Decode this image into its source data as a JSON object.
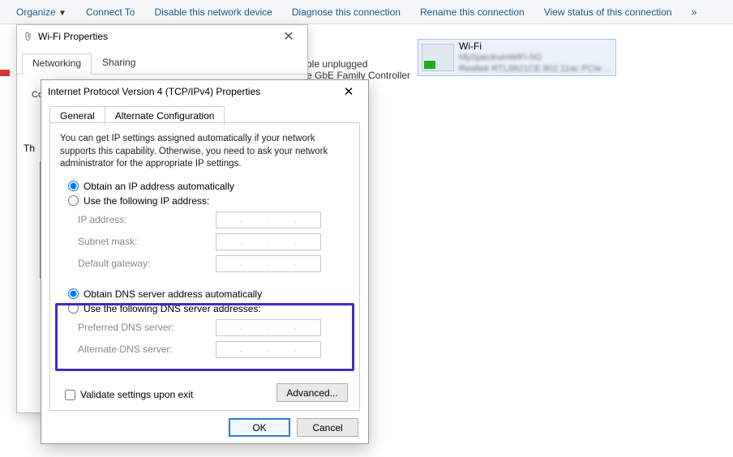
{
  "toolbar": {
    "organize": "Organize",
    "connect_to": "Connect To",
    "disable": "Disable this network device",
    "diagnose": "Diagnose this connection",
    "rename": "Rename this connection",
    "view_status": "View status of this connection",
    "more": "»"
  },
  "wifi_tile": {
    "title": "Wi-Fi",
    "line2": "MySpectrumWiFi-5G",
    "line3": "Realtek RTL8821CE 802.11ac PCIe ..."
  },
  "peek": {
    "unplugged": "ble unplugged",
    "controller": "e GbE Family Controller"
  },
  "dlg1": {
    "title": "Wi-Fi Properties",
    "tab_networking": "Networking",
    "tab_sharing": "Sharing",
    "connect_using": "Co",
    "th": "Th"
  },
  "dlg2": {
    "title": "Internet Protocol Version 4 (TCP/IPv4) Properties",
    "tab_general": "General",
    "tab_alt": "Alternate Configuration",
    "description": "You can get IP settings assigned automatically if your network supports this capability. Otherwise, you need to ask your network administrator for the appropriate IP settings.",
    "radio_ip_auto": "Obtain an IP address automatically",
    "radio_ip_manual": "Use the following IP address:",
    "ip_address": "IP address:",
    "subnet": "Subnet mask:",
    "gateway": "Default gateway:",
    "radio_dns_auto": "Obtain DNS server address automatically",
    "radio_dns_manual": "Use the following DNS server addresses:",
    "dns_pref": "Preferred DNS server:",
    "dns_alt": "Alternate DNS server:",
    "validate": "Validate settings upon exit",
    "advanced": "Advanced...",
    "ok": "OK",
    "cancel": "Cancel"
  }
}
